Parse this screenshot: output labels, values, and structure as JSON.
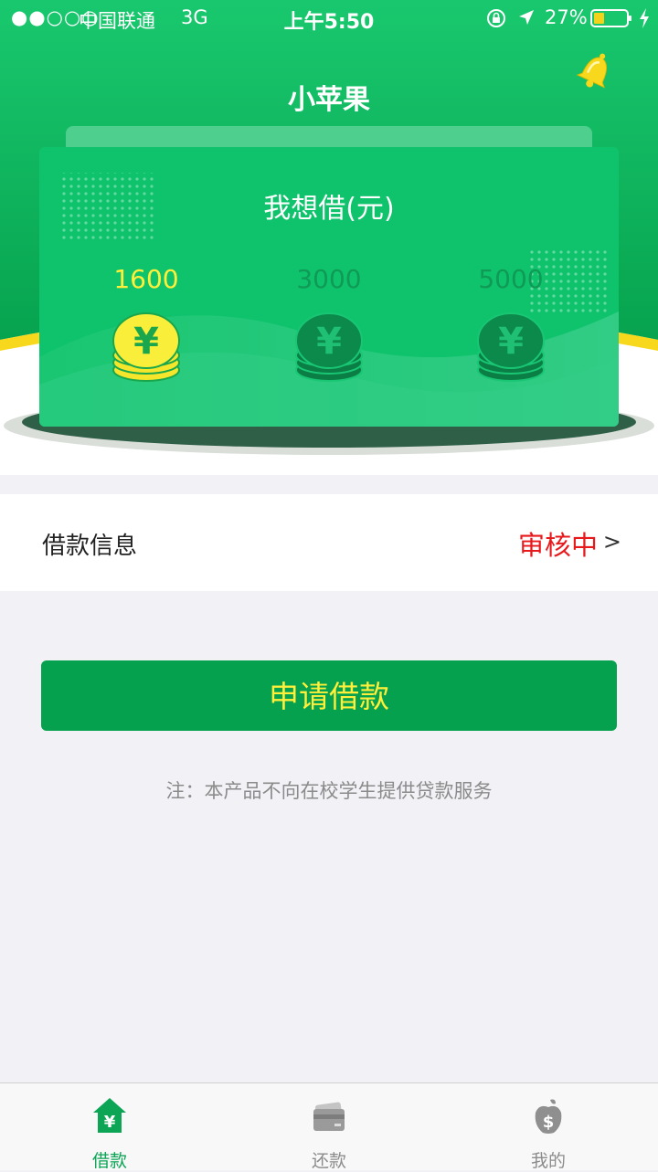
{
  "status_bar": {
    "signal": "●●○○○",
    "carrier": "中国联通",
    "network": "3G",
    "time": "上午5:50",
    "battery_percent": "27%"
  },
  "header": {
    "title": "小苹果",
    "icons": [
      "bell-icon"
    ]
  },
  "loan_card": {
    "title": "我想借(元)",
    "options": [
      {
        "amount": "1600",
        "selected": true,
        "icon": "coin-stack-icon"
      },
      {
        "amount": "3000",
        "selected": false,
        "icon": "coin-stack-icon"
      },
      {
        "amount": "5000",
        "selected": false,
        "icon": "coin-stack-icon"
      }
    ],
    "coin_symbol": "¥"
  },
  "loan_info": {
    "label": "借款信息",
    "status": "审核中",
    "chevron": ">"
  },
  "apply_button": {
    "label": "申请借款"
  },
  "note": "注：本产品不向在校学生提供贷款服务",
  "tabbar": {
    "tabs": [
      {
        "label": "借款",
        "icon": "home-yen-icon",
        "active": true
      },
      {
        "label": "还款",
        "icon": "card-icon",
        "active": false
      },
      {
        "label": "我的",
        "icon": "apple-dollar-icon",
        "active": false
      }
    ]
  },
  "colors": {
    "brand_green": "#05a14e",
    "card_green": "#0fc36c",
    "selected_yellow": "#ffef3b",
    "status_red": "#e8191c"
  }
}
